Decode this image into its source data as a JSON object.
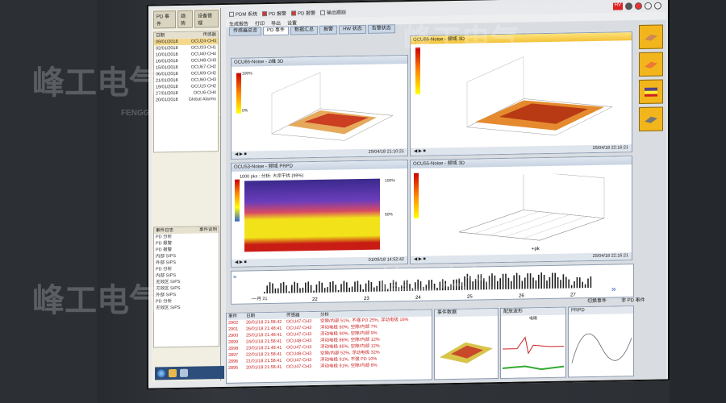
{
  "watermark": {
    "brand_cn": "峰工电气",
    "brand_en": "FENGGONG ELECTRICAL"
  },
  "left_panel": {
    "tabs": [
      "PD 事件",
      "趋势",
      "设备管理"
    ],
    "list_header": [
      "日期",
      "传感器"
    ],
    "rows": [
      [
        "09/01/2018",
        "OCU24-CH3"
      ],
      [
        "02/01/2018",
        "OCU33-CH1"
      ],
      [
        "10/01/2018",
        "OCU40-CH4"
      ],
      [
        "16/01/2018",
        "OCU48-CH3"
      ],
      [
        "15/01/2018",
        "OCU67-CH2"
      ],
      [
        "06/01/2018",
        "OCU09-CH2"
      ],
      [
        "21/01/2018",
        "OCU60-CH3"
      ],
      [
        "19/01/2018",
        "OCU15-CH2"
      ],
      [
        "27/01/2018",
        "OCU6-CH4"
      ],
      [
        "20/01/2018",
        "Global Alarms"
      ]
    ],
    "list2_header": [
      "事件日志",
      "事件说明"
    ],
    "list2_rows": [
      "PD 分析",
      "PD 报警",
      "PD 报警",
      "内部 SIPS",
      "外部 SIPS",
      "PD 分析",
      "内部 SIPS",
      "无效区 SIPS",
      "无效区 SIPS",
      "外部 SIPS",
      "PD 分析",
      "无效区 SIPS"
    ]
  },
  "topbar": {
    "items": [
      "PDM 系统",
      "PD 报警",
      "PD 报警",
      "输出跟踪"
    ]
  },
  "toolbar": {
    "items": [
      "生成报告",
      "打印",
      "导出",
      "设置"
    ]
  },
  "tabs": [
    "传感器总览",
    "PD 事件",
    "数据汇总",
    "报警",
    "HW 状态",
    "告警状态"
  ],
  "panels": {
    "p1": {
      "title": "OCU65-Noise - 2维 3D",
      "footer": "25/04/18 21:10:21"
    },
    "p2": {
      "title": "OCU66-Noise - 频域 3D",
      "footer": "25/04/18 22:16:21"
    },
    "p3": {
      "title": "OCU53-Noise - 频域 PRPD",
      "subtitle": "1000 pks : 分析: 大宗干扰 (99%)",
      "footer": "01/05/18 14:52:42"
    },
    "p4": {
      "title": "OCU55-Noise - 频域 3D",
      "footer": "25/04/18 22:16:21"
    }
  },
  "colorbar_labels": {
    "top": "100%",
    "mid": "50%",
    "bottom": "0%"
  },
  "axis_labels": {
    "x_ticks": [
      "0",
      "10",
      "20",
      "30",
      "40",
      "50",
      "60",
      "70",
      "80",
      "90"
    ],
    "pk": "+pk",
    "mpk": "-pk"
  },
  "timeline": {
    "label": "-一月 21",
    "dates": [
      "22",
      "23",
      "24",
      "25",
      "26",
      "27"
    ]
  },
  "events": {
    "headers": [
      "事件",
      "日期",
      "传感器",
      "分析"
    ],
    "rows": [
      [
        "2902",
        "26/01/18 21:58:42",
        "OCU47-CH3",
        "空隙/内部 51%, 不强 PD 25%, 浮动电极 16%"
      ],
      [
        "2901",
        "26/01/18 21:48:41",
        "OCU47-CH3",
        "浮动电极 90%, 空隙/内部 7%"
      ],
      [
        "2900",
        "25/01/18 21:48:41",
        "OCU47-CH3",
        "浮动电极 90%, 空隙/内部 9%"
      ],
      [
        "2899",
        "24/01/18 21:58:41",
        "OCU48-CH3",
        "浮动电极 86%, 空隙/内部 12%"
      ],
      [
        "2898",
        "23/01/18 21:48:41",
        "OCU47-CH3",
        "浮动电极 85%, 空隙/内部 12%"
      ],
      [
        "2897",
        "22/01/18 21:58:41",
        "OCU48-CH3",
        "空隙/内部 52%, 浮动电极 32%"
      ],
      [
        "2896",
        "21/01/18 21:58:41",
        "OCU47-CH3",
        "浮动电极 91%, 不强 PD 10%"
      ],
      [
        "2895",
        "20/01/18 21:58:41",
        "OCU47-CH3",
        "浮动电极 91%, 空隙/内部 8%"
      ]
    ]
  },
  "mini": {
    "events_title": "事件数据",
    "wave_title": "配放波形",
    "prpd_title": "PRPD",
    "switch_event": "切换事件",
    "non_pd": "非 PD 事件",
    "wave_label": "电磁"
  },
  "colors": {
    "accent": "#f3b51c",
    "alarm": "#cc2222",
    "plot_red": "#c81c14",
    "plot_yellow": "#f2e21a",
    "plot_purple": "#4b2a9a"
  }
}
